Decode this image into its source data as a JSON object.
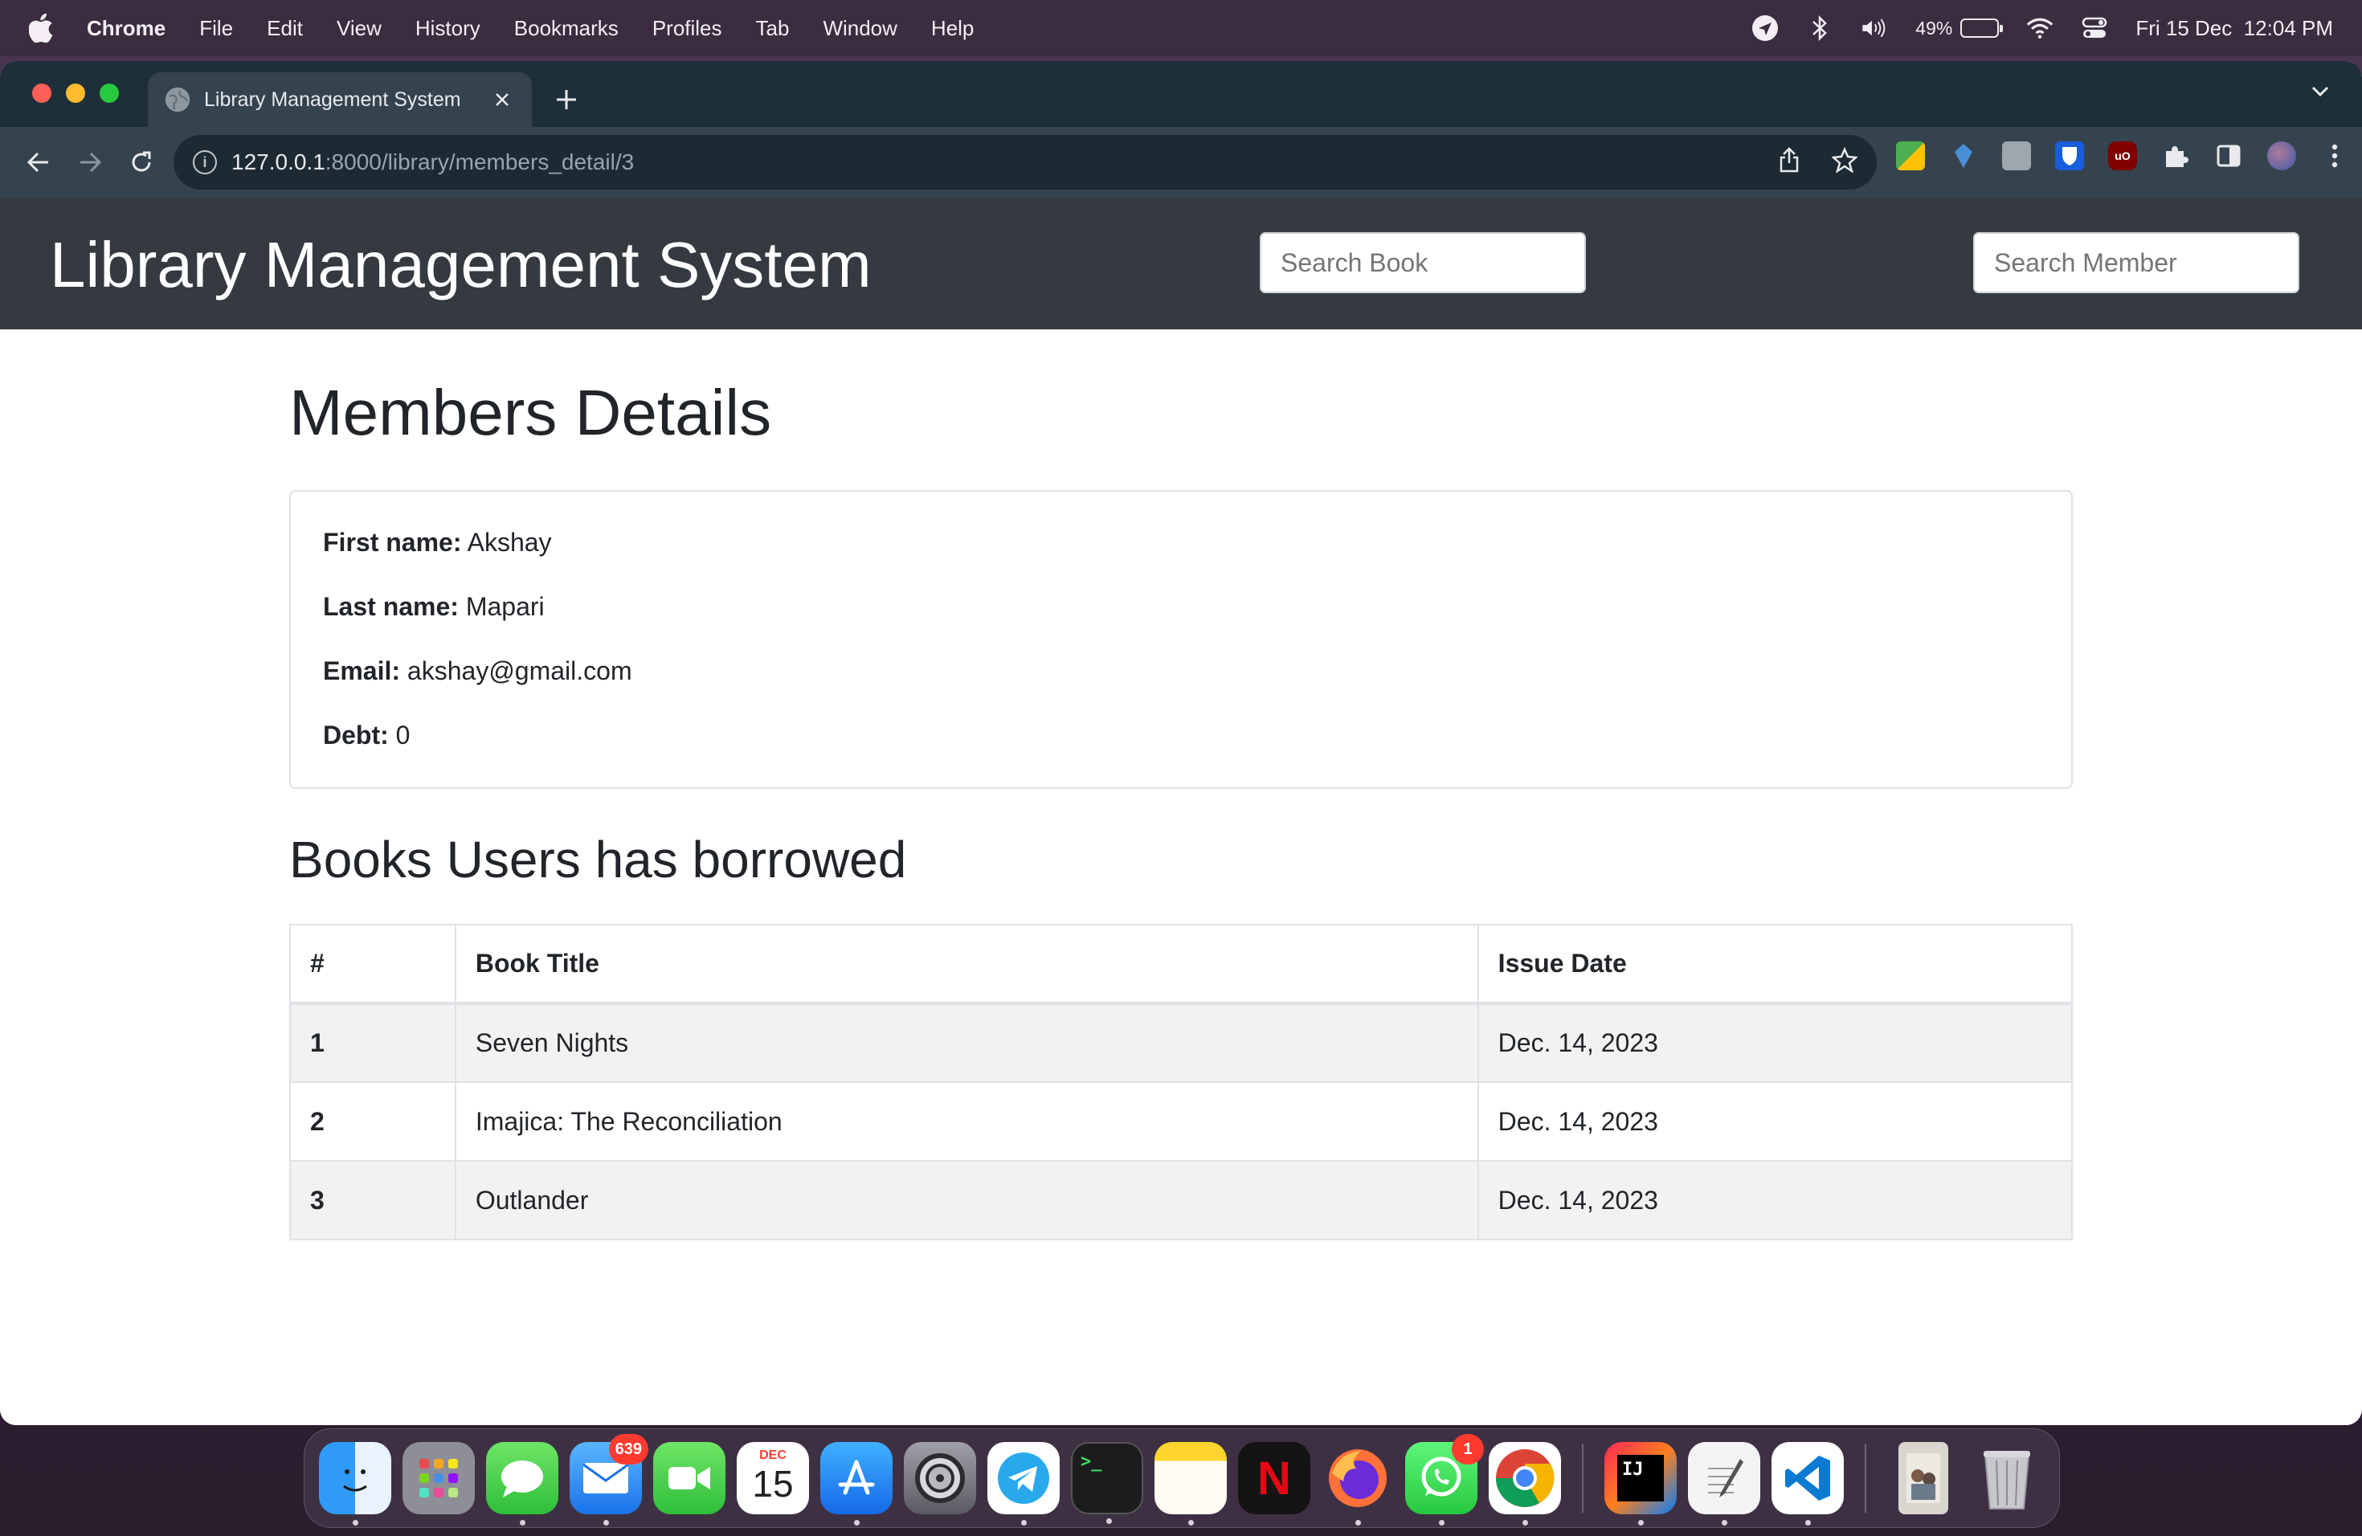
{
  "menubar": {
    "app_name": "Chrome",
    "items": [
      "File",
      "Edit",
      "View",
      "History",
      "Bookmarks",
      "Profiles",
      "Tab",
      "Window",
      "Help"
    ],
    "battery_percent": "49%",
    "battery_level": 0.49,
    "datetime": "Fri 15 Dec  12:04 PM"
  },
  "browser": {
    "tab_title": "Library Management System",
    "url_host": "127.0.0.1",
    "url_path": ":8000/library/members_detail/3"
  },
  "site": {
    "title": "Library Management System",
    "search_book_placeholder": "Search Book",
    "search_member_placeholder": "Search Member"
  },
  "member": {
    "heading": "Members Details",
    "first_name_label": "First name:",
    "first_name": "Akshay",
    "last_name_label": "Last name:",
    "last_name": "Mapari",
    "email_label": "Email:",
    "email": "akshay@gmail.com",
    "debt_label": "Debt:",
    "debt": "0"
  },
  "borrowed": {
    "heading": "Books Users has borrowed",
    "columns": [
      "#",
      "Book Title",
      "Issue Date"
    ],
    "rows": [
      {
        "num": "1",
        "title": "Seven Nights",
        "date": "Dec. 14, 2023"
      },
      {
        "num": "2",
        "title": "Imajica: The Reconciliation",
        "date": "Dec. 14, 2023"
      },
      {
        "num": "3",
        "title": "Outlander",
        "date": "Dec. 14, 2023"
      }
    ]
  },
  "dock": {
    "mail_badge": "639",
    "whatsapp_badge": "1",
    "calendar_month": "DEC",
    "calendar_day": "15",
    "jetbrains_label": "IJ"
  }
}
